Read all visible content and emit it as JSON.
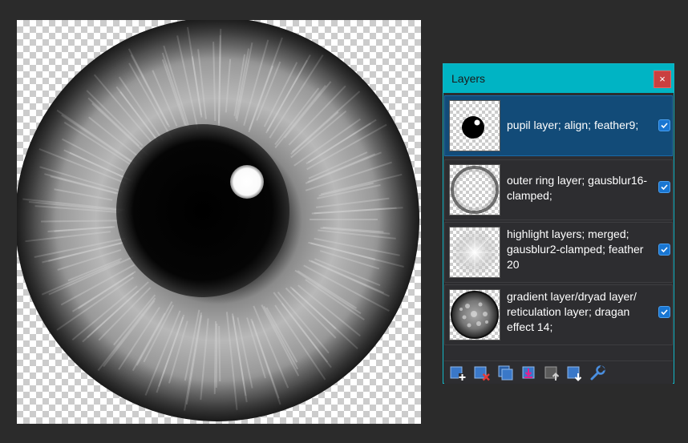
{
  "panel": {
    "title": "Layers",
    "close_label": "×"
  },
  "layers": [
    {
      "name": "pupil layer; align; feather9;",
      "visible": true,
      "selected": true,
      "thumb": "pupil"
    },
    {
      "name": "outer ring layer; gausblur16-clamped;",
      "visible": true,
      "selected": false,
      "thumb": "ring"
    },
    {
      "name": "highlight layers; merged; gausblur2-clamped; feather 20",
      "visible": true,
      "selected": false,
      "thumb": "highlight"
    },
    {
      "name": "gradient layer/dryad layer/ reticulation layer; dragan effect 14;",
      "visible": true,
      "selected": false,
      "thumb": "iris"
    }
  ],
  "toolbar": [
    {
      "icon": "add-layer-icon"
    },
    {
      "icon": "delete-layer-icon"
    },
    {
      "icon": "duplicate-layer-icon"
    },
    {
      "icon": "merge-layer-down-icon"
    },
    {
      "icon": "move-layer-up-icon"
    },
    {
      "icon": "move-layer-down-icon"
    },
    {
      "icon": "layer-properties-icon"
    }
  ],
  "colors": {
    "header": "#00b4c4",
    "selected_row": "#124b78",
    "checkbox": "#1976d2",
    "close": "#c94040"
  }
}
